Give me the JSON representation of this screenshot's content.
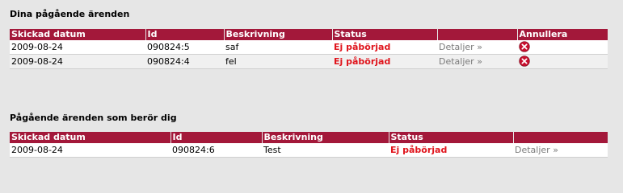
{
  "section1": {
    "title": "Dina pågående ärenden",
    "headers": [
      "Skickad datum",
      "Id",
      "Beskrivning",
      "Status",
      "",
      "Annullera"
    ],
    "rows": [
      {
        "date": "2009-08-24",
        "id": "090824:5",
        "description": "saf",
        "status": "Ej påbörjad",
        "details": "Detaljer »",
        "cancel_icon": "cancel-icon"
      },
      {
        "date": "2009-08-24",
        "id": "090824:4",
        "description": "fel",
        "status": "Ej påbörjad",
        "details": "Detaljer »",
        "cancel_icon": "cancel-icon"
      }
    ]
  },
  "section2": {
    "title": "Pågående ärenden som berör dig",
    "headers": [
      "Skickad datum",
      "Id",
      "Beskrivning",
      "Status",
      ""
    ],
    "rows": [
      {
        "date": "2009-08-24",
        "id": "090824:6",
        "description": "Test",
        "status": "Ej påbörjad",
        "details": "Detaljer »"
      }
    ]
  },
  "colors": {
    "header_bg": "#a3183a",
    "status_red": "#e0141c",
    "page_bg": "#e6e6e6",
    "cancel_icon_red": "#c8102e"
  }
}
